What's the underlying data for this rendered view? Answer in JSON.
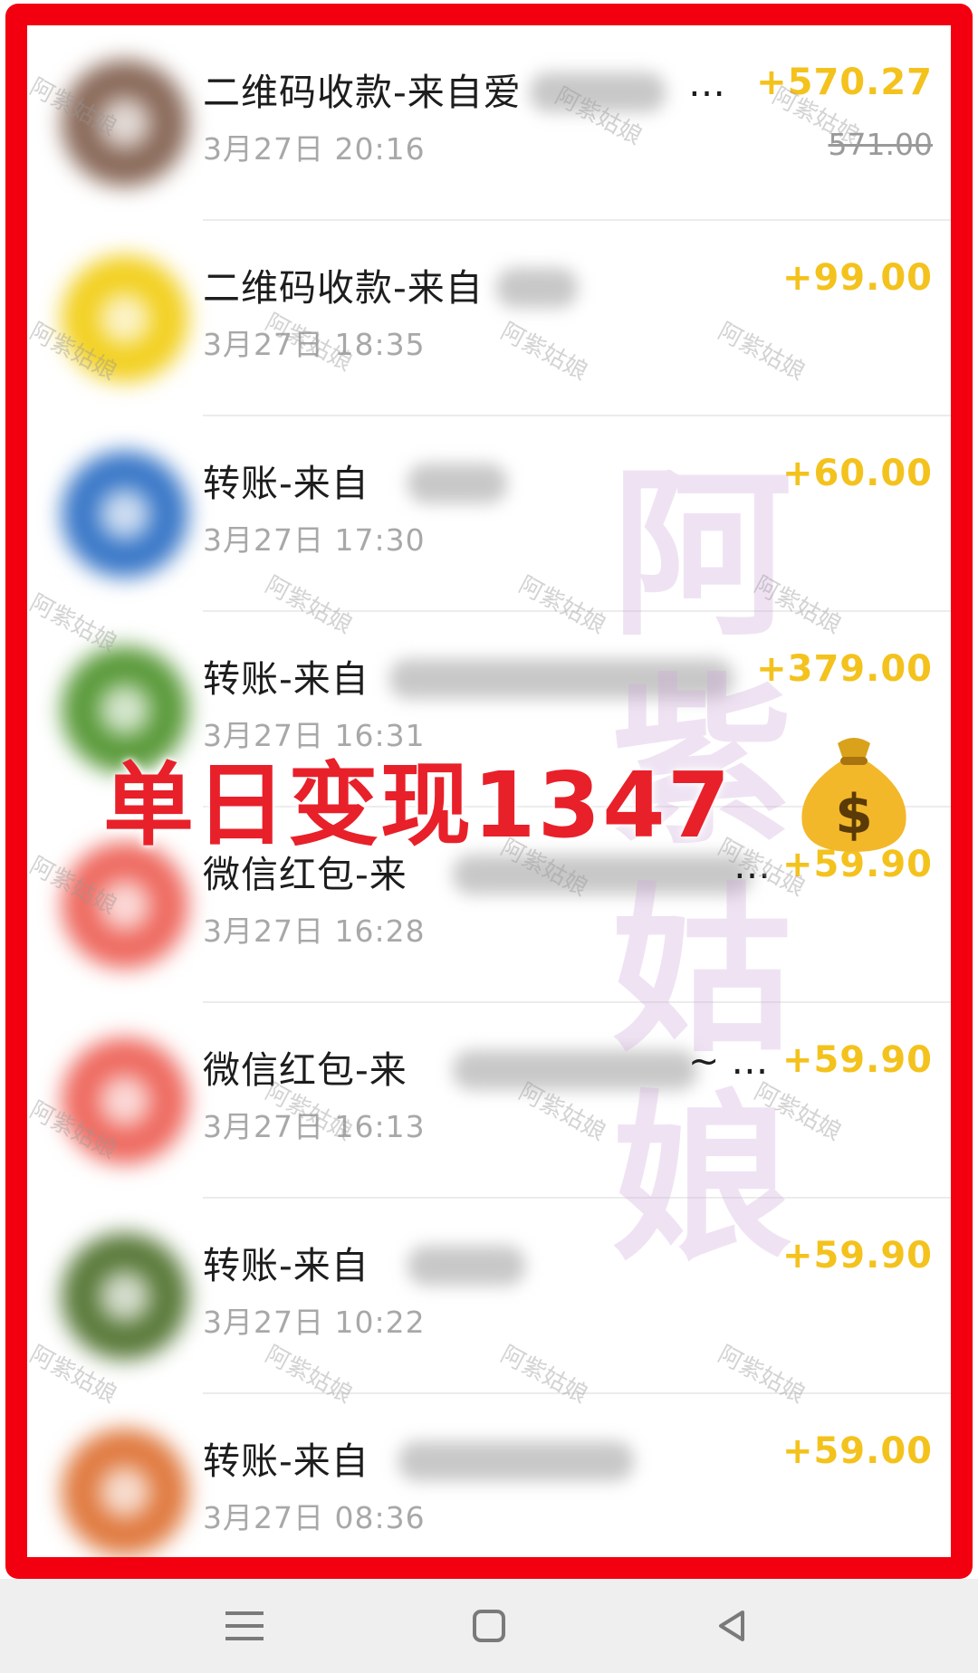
{
  "transactions": [
    {
      "title": "二维码收款-来自爱",
      "suffix": "…",
      "time": "3月27日 20:16",
      "amount": "+570.27",
      "original": "571.00",
      "avatar_color": "#8a6a5a"
    },
    {
      "title": "二维码收款-来自",
      "suffix": "",
      "time": "3月27日 18:35",
      "amount": "+99.00",
      "original": "",
      "avatar_color": "#f2d020"
    },
    {
      "title": "转账-来自",
      "suffix": "",
      "time": "3月27日 17:30",
      "amount": "+60.00",
      "original": "",
      "avatar_color": "#3a78c8"
    },
    {
      "title": "转账-来自",
      "suffix": "",
      "time": "3月27日 16:31",
      "amount": "+379.00",
      "original": "",
      "avatar_color": "#5a9a3a"
    },
    {
      "title": "微信红包-来",
      "suffix": "…",
      "time": "3月27日 16:28",
      "amount": "+59.90",
      "original": "",
      "avatar_color": "#ee6a60"
    },
    {
      "title": "微信红包-来",
      "suffix": "~ …",
      "time": "3月27日 16:13",
      "amount": "+59.90",
      "original": "",
      "avatar_color": "#ee6a60"
    },
    {
      "title": "转账-来自",
      "suffix": "",
      "time": "3月27日 10:22",
      "amount": "+59.90",
      "original": "",
      "avatar_color": "#5a7a3a"
    },
    {
      "title": "转账-来自",
      "suffix": "",
      "time": "3月27日 08:36",
      "amount": "+59.00",
      "original": "",
      "avatar_color": "#e07a40"
    }
  ],
  "banner": {
    "text": "单日变现1347",
    "icon": "money-bag-icon"
  },
  "watermark": {
    "big": "阿紫姑娘",
    "small": "阿紫姑娘"
  },
  "navbar": {
    "buttons": [
      "menu-icon",
      "home-icon",
      "back-icon"
    ]
  },
  "colors": {
    "frame": "#f2000f",
    "amount": "#f4c21d",
    "banner": "#e8202a"
  }
}
